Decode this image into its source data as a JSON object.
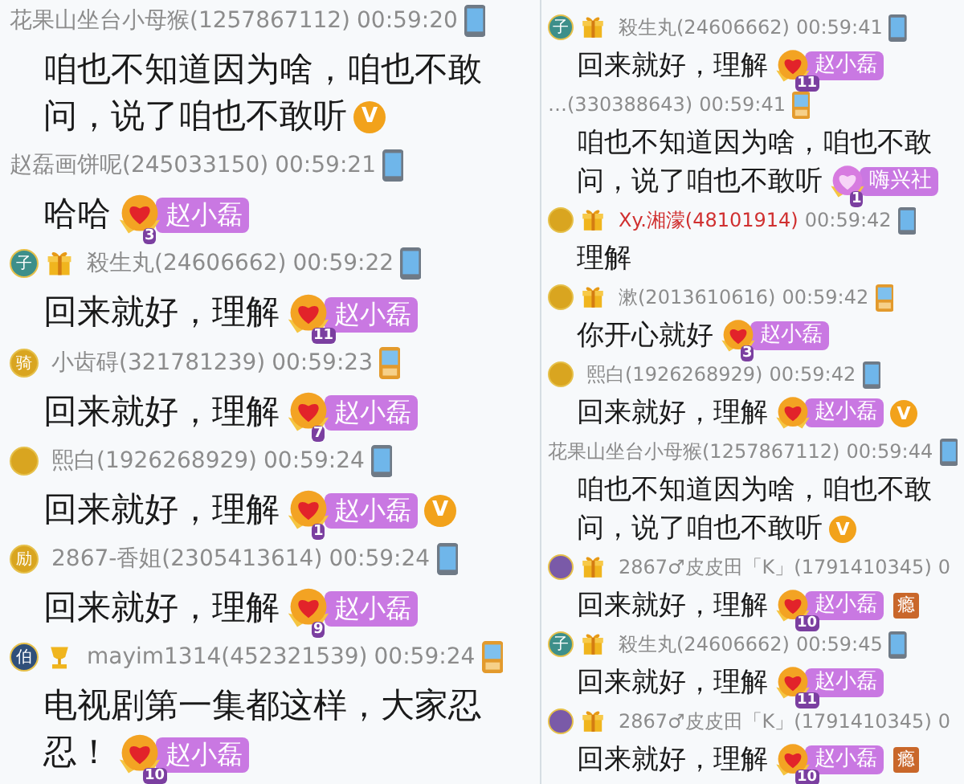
{
  "panels": [
    {
      "messages": [
        {
          "sender": "花果山坐台小母猴(1257867112)",
          "color": "#8c8c8c",
          "time": "00:59:20",
          "device": {
            "kind": "smartphone"
          },
          "lines": [
            "咱也不知道因为啥，咱也不敢",
            "问，说了咱也不敢听"
          ],
          "vip": "V"
        },
        {
          "sender": "赵磊画饼呢(245033150)",
          "color": "#8c8c8c",
          "time": "00:59:21",
          "device": {
            "kind": "smartphone"
          },
          "lines": [
            "哈哈"
          ],
          "sticker": {
            "kind": "gold",
            "level": "3",
            "name": "赵小磊"
          }
        },
        {
          "badges": [
            {
              "kind": "rank",
              "color": "#3d8f8a",
              "label": "子"
            },
            {
              "kind": "gift"
            }
          ],
          "sender": "殺生丸(24606662)",
          "color": "#8c8c8c",
          "time": "00:59:22",
          "device": {
            "kind": "smartphone"
          },
          "lines": [
            "回来就好，理解"
          ],
          "sticker": {
            "kind": "gold",
            "level": "11",
            "name": "赵小磊"
          }
        },
        {
          "badges": [
            {
              "kind": "rank",
              "color": "#d9a520",
              "label": "骑"
            }
          ],
          "sender": "小齿碍(321781239)",
          "color": "#8c8c8c",
          "time": "00:59:23",
          "device": {
            "kind": "featurephone"
          },
          "lines": [
            "回来就好，理解"
          ],
          "sticker": {
            "kind": "gold",
            "level": "7",
            "name": "赵小磊"
          }
        },
        {
          "badges": [
            {
              "kind": "rank",
              "color": "#d9a520"
            }
          ],
          "sender": "熙白(1926268929)",
          "color": "#8c8c8c",
          "time": "00:59:24",
          "device": {
            "kind": "smartphone"
          },
          "lines": [
            "回来就好，理解"
          ],
          "sticker": {
            "kind": "gold",
            "level": "1",
            "name": "赵小磊"
          },
          "vip": "V"
        },
        {
          "badges": [
            {
              "kind": "rank",
              "color": "#d9a520",
              "label": "励"
            }
          ],
          "sender": "2867-香姐(2305413614)",
          "color": "#8c8c8c",
          "time": "00:59:24",
          "device": {
            "kind": "smartphone"
          },
          "lines": [
            "回来就好，理解"
          ],
          "sticker": {
            "kind": "gold",
            "level": "9",
            "name": "赵小磊"
          }
        },
        {
          "badges": [
            {
              "kind": "rank",
              "color": "#2f4f7a",
              "label": "伯"
            },
            {
              "kind": "cup"
            }
          ],
          "sender": "mayim1314(452321539)",
          "color": "#8c8c8c",
          "time": "00:59:24",
          "device": {
            "kind": "featurephone"
          },
          "lines": [
            "电视剧第一集都这样，大家忍",
            "忍！"
          ],
          "sticker": {
            "kind": "gold",
            "level": "10",
            "name": "赵小磊"
          }
        }
      ]
    },
    {
      "messages": [
        {
          "badges": [
            {
              "kind": "rank",
              "color": "#3d8f8a",
              "label": "子"
            },
            {
              "kind": "gift"
            }
          ],
          "sender": "殺生丸(24606662)",
          "color": "#8c8c8c",
          "time": "00:59:41",
          "device": {
            "kind": "smartphone"
          },
          "lines": [
            "回来就好，理解"
          ],
          "sticker": {
            "kind": "gold",
            "level": "11",
            "name": "赵小磊"
          }
        },
        {
          "sender": "…(330388643)",
          "color": "#8c8c8c",
          "time": "00:59:41",
          "device": {
            "kind": "featurephone"
          },
          "lines": [
            "咱也不知道因为啥，咱也不敢",
            "问，说了咱也不敢听"
          ],
          "sticker": {
            "kind": "pink",
            "level": "1",
            "name": "嗨兴社"
          }
        },
        {
          "badges": [
            {
              "kind": "rank",
              "color": "#d9a520"
            },
            {
              "kind": "gift"
            }
          ],
          "sender": "Xy.湘濛(48101914)",
          "color": "#d03030",
          "time": "00:59:42",
          "device": {
            "kind": "smartphone"
          },
          "lines": [
            "理解"
          ]
        },
        {
          "badges": [
            {
              "kind": "rank",
              "color": "#d9a520"
            },
            {
              "kind": "gift"
            }
          ],
          "sender": "漱(2013610616)",
          "color": "#8c8c8c",
          "time": "00:59:42",
          "device": {
            "kind": "featurephone"
          },
          "lines": [
            "你开心就好"
          ],
          "sticker": {
            "kind": "gold",
            "level": "3",
            "name": "赵小磊"
          }
        },
        {
          "badges": [
            {
              "kind": "rank",
              "color": "#d9a520"
            }
          ],
          "sender": "熙白(1926268929)",
          "color": "#8c8c8c",
          "time": "00:59:42",
          "device": {
            "kind": "smartphone"
          },
          "lines": [
            "回来就好，理解"
          ],
          "sticker": {
            "kind": "gold",
            "name": "赵小磊"
          },
          "vip": "V"
        },
        {
          "sender": "花果山坐台小母猴(1257867112)",
          "color": "#8c8c8c",
          "time": "00:59:44",
          "device": {
            "kind": "smartphone"
          },
          "lines": [
            "咱也不知道因为啥，咱也不敢",
            "问，说了咱也不敢听"
          ],
          "vip": "V"
        },
        {
          "badges": [
            {
              "kind": "rank",
              "color": "#7a5aa8"
            },
            {
              "kind": "gift"
            }
          ],
          "sender": "2867♂皮皮田「K」(1791410345)",
          "color": "#8c8c8c",
          "time": "0",
          "lines": [
            "回来就好，理解"
          ],
          "sticker": {
            "kind": "gold",
            "level": "10",
            "name": "赵小磊"
          },
          "tag": "瘾"
        },
        {
          "badges": [
            {
              "kind": "rank",
              "color": "#3d8f8a",
              "label": "子"
            },
            {
              "kind": "gift"
            }
          ],
          "sender": "殺生丸(24606662)",
          "color": "#8c8c8c",
          "time": "00:59:45",
          "device": {
            "kind": "smartphone"
          },
          "lines": [
            "回来就好，理解"
          ],
          "sticker": {
            "kind": "gold",
            "level": "11",
            "name": "赵小磊"
          }
        },
        {
          "badges": [
            {
              "kind": "rank",
              "color": "#7a5aa8"
            },
            {
              "kind": "gift"
            }
          ],
          "sender": "2867♂皮皮田「K」(1791410345)",
          "color": "#8c8c8c",
          "time": "0",
          "lines": [
            "回来就好，理解"
          ],
          "sticker": {
            "kind": "gold",
            "level": "10",
            "name": "赵小磊"
          },
          "tag": "瘾"
        }
      ]
    }
  ]
}
